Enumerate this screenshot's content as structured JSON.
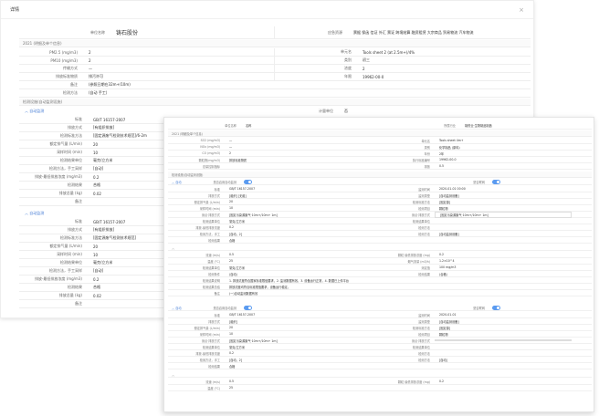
{
  "dialog": {
    "title": "详情",
    "close": "×"
  },
  "back": {
    "company_label": "单位名称",
    "company_value": "铸石股份",
    "scope_label": "应急资源",
    "scope_tags": "票据 保函 信证 外汇 票证 跨境结算 融资租赁 大宗商品 贸易物流 汽车物流",
    "section1": "2021 (明细及单个信息)",
    "r1": [
      [
        "PM2.5 (mg/m3)",
        "2",
        "单元名",
        "Tools sheet 2 (at 2.5m+)/4%"
      ]
    ],
    "r2": [
      [
        "PM10 (mg/m3)",
        "2",
        "类别",
        "初三"
      ]
    ],
    "r3": [
      [
        "传输方式",
        "—",
        "浓度",
        "2"
      ]
    ],
    "r4": [
      [
        "排放标准物质",
        "排污许可",
        "年限",
        "19962-00-0"
      ]
    ],
    "remark_label": "备注",
    "remark_value": "(参照日期在32m+/10m)",
    "monitor_label": "检测方法",
    "monitor_value": "(自动  手工)",
    "section2": "检测设施(自动监测设施)",
    "group1_title": "自动监测",
    "group1_rows": [
      [
        "标准",
        "GB/T 16157-2007"
      ],
      [
        "排放方式",
        "[有组织排放]"
      ],
      [
        "检测标准方法",
        "[固定源废气检测技术规范]/6-2m"
      ],
      [
        "额定排气量 (L/min)",
        "20"
      ],
      [
        "采样时间 (min)",
        "10"
      ],
      [
        "检测结果单位",
        "毫克/立方米"
      ],
      [
        "检测方法，手工采样",
        "[自动]"
      ],
      [
        "排放-最低排放浓度 (mg/m3)",
        "0.2"
      ],
      [
        "检测结果",
        "合格"
      ],
      [
        "排放总量 (kg)",
        "0.02"
      ],
      [
        "备注",
        ""
      ]
    ],
    "right_col_label": "计量单位",
    "right_col_value": "否",
    "group2_title": "自动监测",
    "group2_rows": [
      [
        "标准",
        "GB/T 16157-2007"
      ],
      [
        "排放方式",
        "[有组织排放]"
      ],
      [
        "检测标准方法",
        "[固定源废气检测技术规范]"
      ],
      [
        "额定排气量 (L/min)",
        "20"
      ],
      [
        "采样时间 (min)",
        "10"
      ],
      [
        "检测结果单位",
        "毫克/立方米"
      ],
      [
        "检测方法，手工采样",
        "[自动]"
      ],
      [
        "排放-最低排放浓度 (mg/m3)",
        "0.2"
      ],
      [
        "检测结果",
        "合格"
      ],
      [
        "排放总量 (kg)",
        "0.02"
      ],
      [
        "备注",
        ""
      ]
    ]
  },
  "front": {
    "name_label": "单位名称",
    "name_value": "名称",
    "scope_label": "所属行业",
    "scope_value": "制药业·生物制品制造",
    "section1": "2021 (明细及单个信息)",
    "rows": [
      [
        "SO2 (mg/m3)",
        "—",
        "单元名",
        "Tools sheet 4m+"
      ],
      [
        "NOx (mg/m3)",
        "—",
        "类别",
        "化学制品 (原料)"
      ],
      [
        "CO (mg/m3)",
        "2",
        "年份",
        "2年"
      ],
      [
        "颗粒物(mg/m3)",
        "排放标准物质",
        "执行标准编号",
        "19962-00-0"
      ],
      [
        "总量控制指标",
        "",
        "排放",
        "0.5"
      ]
    ],
    "section2": "检测设施(自动监测设施)",
    "blockA_title": "自动",
    "blockA_toggle_label": "是否启用自动监测",
    "blockA_right_label": "是否联网",
    "blockA_rows": [
      [
        "标准",
        "GB/T 16157-2007",
        "监测时间",
        "2020-01-01 00:00"
      ],
      [
        "排放方式",
        "[组织]  [无组]",
        "监测类型",
        "[自动监测设备]"
      ],
      [
        "额定排气量 (L/min)",
        "20",
        "检测标准方法",
        "[固定源]"
      ],
      [
        "采样时间 (min)",
        "10",
        "检测项目",
        "颗粒物"
      ],
      [
        "测点·排放方式",
        "[固定污染源废气·10m+/10m+ 1m]",
        "测点·排放方式",
        "[固定污染源废气·10m+/10m+ 1m]"
      ],
      [
        "检测结果单位",
        "毫克/立方米",
        "检测结果单位",
        ""
      ],
      [
        "排放-最低排放浓度",
        "0.2",
        "检测方法",
        ""
      ],
      [
        "检测方法，手工",
        "[自动，2]",
        "检测方法",
        "[自动监测设备]"
      ],
      [
        "检测结果",
        "合格",
        "",
        ""
      ]
    ],
    "blockA_sub": "排气筒",
    "blockA_extra": [
      [
        "流速 (m/s)",
        "0.5",
        "颗粒·最低排放浓度 (mg)",
        "0.2"
      ],
      [
        "温度 (°C)",
        "25",
        "烟气流量 (m3/h)",
        "1.2×10^4"
      ],
      [
        "检测结果单位",
        "毫克/立方米",
        "测定值",
        "100 mg/m3"
      ],
      [
        "检测条件",
        "(自动)",
        "检测结果",
        "(合格)"
      ],
      [
        "检测结果说明",
        "1. 排放浓度符合国家标准限值要求，2. 监测数据有效，3. 设备运行正常，4. 数据已上传平台",
        "",
        ""
      ],
      [
        "检测结果总结",
        "排放浓度均符合标准限值要求，设备运行稳定。",
        "",
        ""
      ],
      [
        "备注",
        "(一)自动监测数据有效",
        "",
        ""
      ]
    ],
    "blockB_title": "自动",
    "blockB_toggle_label": "是否启用自动监测",
    "blockB_right_label": "是否联网",
    "blockB_rows": [
      [
        "标准",
        "GB/T 16157-2007",
        "监测时间",
        "2020-01-01"
      ],
      [
        "排放方式",
        "[组织]",
        "监测类型",
        "[自动监测设备]"
      ],
      [
        "额定排气量 (L/min)",
        "20",
        "检测标准方法",
        "[固定源]"
      ],
      [
        "采样时间 (min)",
        "10",
        "检测项目",
        "颗粒物"
      ],
      [
        "测点·排放方式",
        "[固定污染源废气·10m+/10m+ 1m]",
        "测点·排放方式",
        ""
      ],
      [
        "检测结果单位",
        "毫克/立方米",
        "检测结果单位",
        ""
      ],
      [
        "排放-最低排放浓度",
        "0.2",
        "检测方法",
        ""
      ],
      [
        "检测方法，手工",
        "[自动，2]",
        "检测方法",
        "[自动]"
      ],
      [
        "检测结果",
        "合格",
        "",
        ""
      ]
    ],
    "blockB_extra": [
      [
        "流速 (m/s)",
        "0.5",
        "颗粒·最低排放浓度 (mg)",
        "0.2"
      ],
      [
        "温度 (°C)",
        "25",
        "",
        ""
      ]
    ]
  },
  "colors": {
    "accent": "#4a7fd6",
    "toggle": "#5b9bf0",
    "border": "#eeeeee"
  }
}
